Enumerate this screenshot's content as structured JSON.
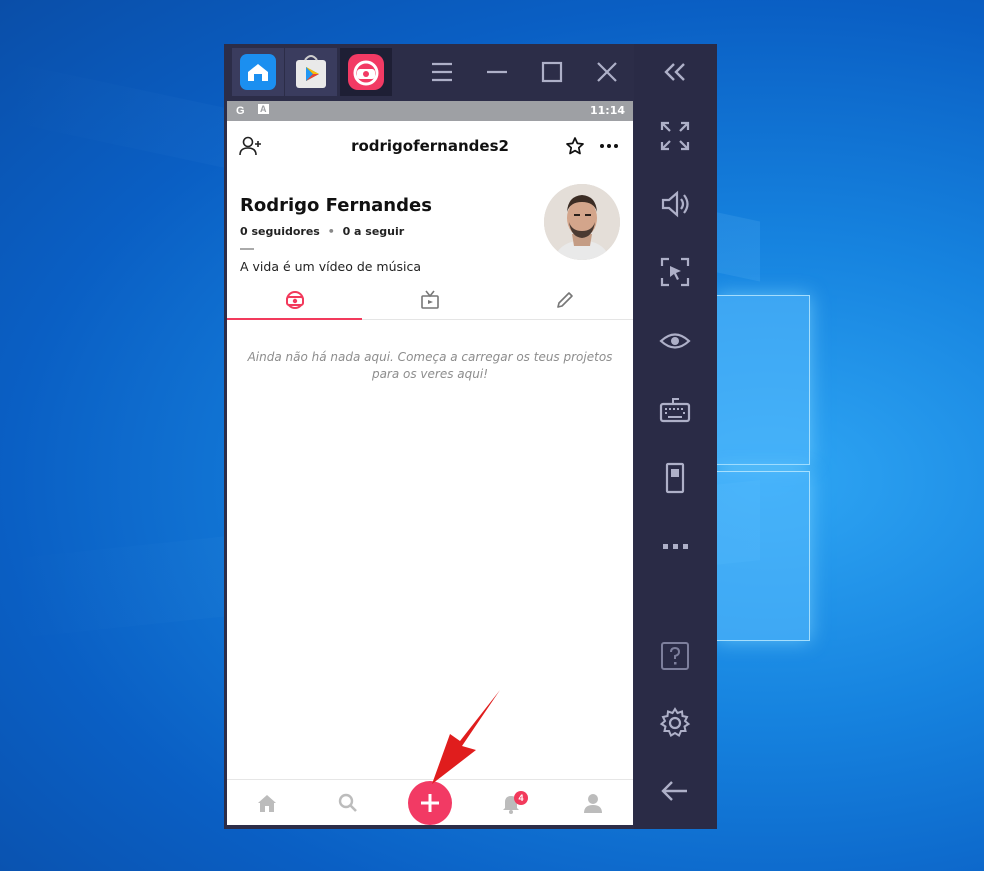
{
  "colors": {
    "accent": "#f23a5c",
    "emulator_bg": "#2c2d48",
    "desktop_blue": "#1683df"
  },
  "emulator": {
    "tabs": [
      {
        "name": "home-tab",
        "icon": "home-icon"
      },
      {
        "name": "play-store-tab",
        "icon": "play-store-icon"
      },
      {
        "name": "app-tab",
        "icon": "app-logo-icon"
      }
    ],
    "window_controls": [
      "menu-icon",
      "minimize-icon",
      "maximize-icon",
      "close-icon"
    ],
    "sidebar_icons": [
      "collapse-icon",
      "fullscreen-icon",
      "volume-icon",
      "screenshot-icon",
      "eye-icon",
      "keyboard-icon",
      "phone-icon",
      "more-icon",
      "help-icon",
      "settings-icon",
      "back-icon"
    ]
  },
  "statusbar": {
    "left_icons": [
      "G",
      "A"
    ],
    "time": "11:14"
  },
  "profile": {
    "username": "rodrigofernandes2",
    "full_name": "Rodrigo Fernandes",
    "followers": "0 seguidores",
    "separator": "•",
    "following": "0 a seguir",
    "bio": "A vida é um vídeo de música",
    "empty_line1": "Ainda não há nada aqui. Começa a carregar os teus projetos",
    "empty_line2": "para os veres aqui!"
  },
  "profile_tabs": [
    "videos-tab",
    "tv-tab",
    "edit-tab"
  ],
  "bottom_nav": [
    "home",
    "search",
    "create",
    "notifications",
    "profile"
  ],
  "notifications_badge": "4"
}
